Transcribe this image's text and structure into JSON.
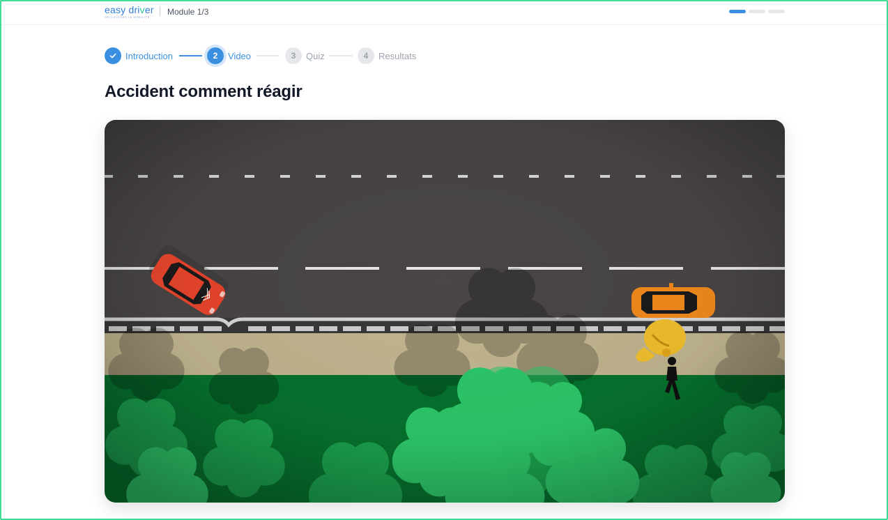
{
  "header": {
    "logo_text": "easy dri",
    "logo_v": "v",
    "logo_end": "er",
    "logo_tagline": "DÉCLOISONS LA MOBILITÉ",
    "module_label": "Module 1/3",
    "progress_segments": [
      {
        "active": true
      },
      {
        "active": false
      },
      {
        "active": false
      }
    ]
  },
  "stepper": {
    "steps": [
      {
        "number": "",
        "icon": "check-icon",
        "label": "Introduction",
        "state": "done"
      },
      {
        "number": "2",
        "label": "Video",
        "state": "current"
      },
      {
        "number": "3",
        "label": "Quiz",
        "state": "todo"
      },
      {
        "number": "4",
        "label": "Resultats",
        "state": "todo"
      }
    ]
  },
  "page": {
    "title": "Accident comment réagir"
  },
  "video": {
    "scene_icons": [
      "crashed-red-car-icon",
      "orange-car-icon",
      "pinching-hand-icon",
      "person-icon",
      "tree-icon"
    ],
    "colors": {
      "road": "#4a4646",
      "sidewalk": "#c2b690",
      "grass": "#07732f",
      "trees": "#2ec86a",
      "red_car": "#e8452c",
      "orange_car": "#f28a1c"
    }
  }
}
